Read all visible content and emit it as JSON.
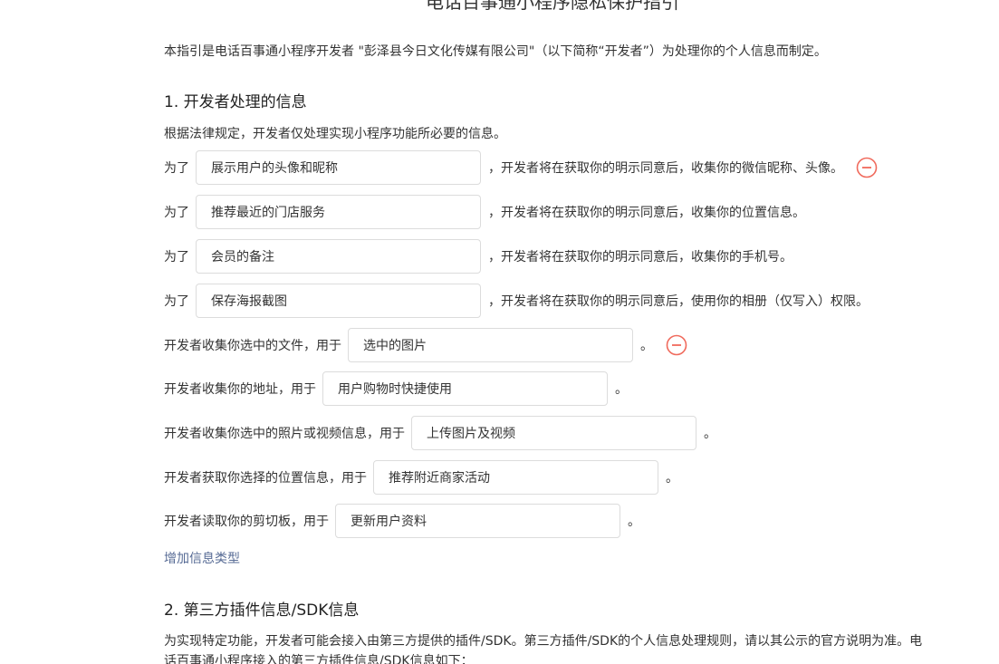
{
  "page": {
    "title": "电话百事通小程序隐私保护指引",
    "intro": "本指引是电话百事通小程序开发者 \"彭泽县今日文化传媒有限公司\"（以下简称“开发者”）为处理你的个人信息而制定。"
  },
  "section1": {
    "heading": "1.  开发者处理的信息",
    "description": "根据法律规定，开发者仅处理实现小程序功能所必要的信息。",
    "purpose_rows": [
      {
        "prefix": "为了",
        "value": "展示用户的头像和昵称",
        "suffix": "，开发者将在获取你的明示同意后，收集你的微信昵称、头像。",
        "removable": true
      },
      {
        "prefix": "为了",
        "value": "推荐最近的门店服务",
        "suffix": "，开发者将在获取你的明示同意后，收集你的位置信息。",
        "removable": false
      },
      {
        "prefix": "为了",
        "value": "会员的备注",
        "suffix": "，开发者将在获取你的明示同意后，收集你的手机号。",
        "removable": false
      },
      {
        "prefix": "为了",
        "value": "保存海报截图",
        "suffix": "，开发者将在获取你的明示同意后，使用你的相册（仅写入）权限。",
        "removable": false
      }
    ],
    "usage_rows": [
      {
        "prefix": "开发者收集你选中的文件，用于",
        "value": "选中的图片",
        "suffix": "。",
        "removable": true
      },
      {
        "prefix": "开发者收集你的地址，用于",
        "value": "用户购物时快捷使用",
        "suffix": "。",
        "removable": false
      },
      {
        "prefix": "开发者收集你选中的照片或视频信息，用于",
        "value": "上传图片及视频",
        "suffix": "。",
        "removable": false
      },
      {
        "prefix": "开发者获取你选择的位置信息，用于",
        "value": "推荐附近商家活动",
        "suffix": "。",
        "removable": false
      },
      {
        "prefix": "开发者读取你的剪切板，用于",
        "value": "更新用户资料",
        "suffix": "。",
        "removable": false
      }
    ],
    "add_link": "增加信息类型"
  },
  "section2": {
    "heading": "2.  第三方插件信息/SDK信息",
    "description": "为实现特定功能，开发者可能会接入由第三方提供的插件/SDK。第三方插件/SDK的个人信息处理规则，请以其公示的官方说明为准。电话百事通小程序接入的第三方插件信息/SDK信息如下："
  },
  "colors": {
    "link": "#576b95",
    "remove_icon": "#f06a5c",
    "field_border": "#dcdcdc",
    "text": "#333333"
  },
  "icons": {
    "remove": "minus-circle-icon"
  }
}
